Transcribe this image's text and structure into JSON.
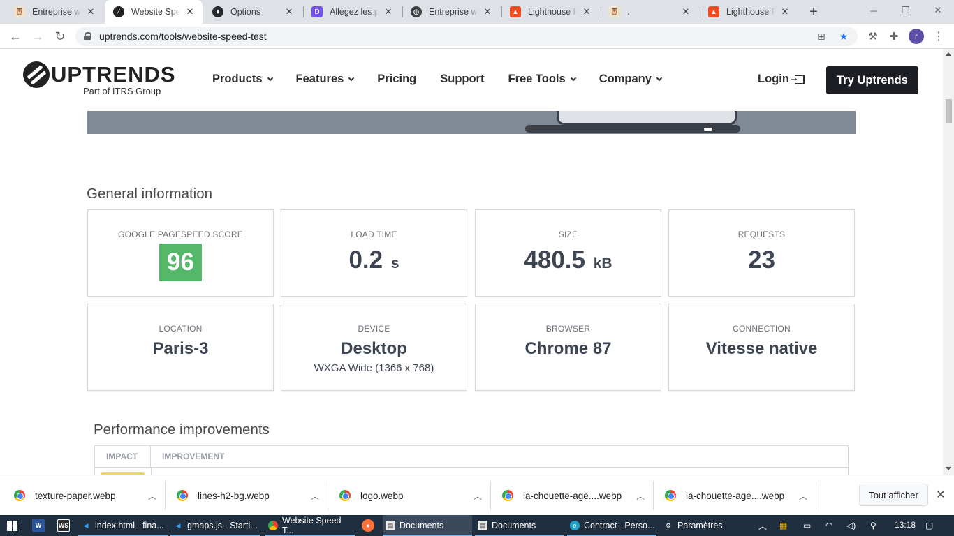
{
  "browser": {
    "tabs": [
      {
        "title": "Entreprise web",
        "favicon": "owl-icon",
        "active": false
      },
      {
        "title": "Website Speed",
        "favicon": "uptrends-icon",
        "active": true
      },
      {
        "title": "Options",
        "favicon": "github-icon",
        "active": false
      },
      {
        "title": "Allégez les pag",
        "favicon": "openclassrooms-icon",
        "active": false
      },
      {
        "title": "Entreprise web",
        "favicon": "globe-icon",
        "active": false
      },
      {
        "title": "Lighthouse Rep",
        "favicon": "lighthouse-icon",
        "active": false
      },
      {
        "title": ".",
        "favicon": "owl-icon",
        "active": false
      },
      {
        "title": "Lighthouse Rep",
        "favicon": "lighthouse-icon",
        "active": false
      }
    ],
    "url": "uptrends.com/tools/website-speed-test",
    "profile_initial": "r"
  },
  "site": {
    "logo_text": "UPTRENDS",
    "logo_sub": "Part of ITRS Group",
    "nav": {
      "products": "Products",
      "features": "Features",
      "pricing": "Pricing",
      "support": "Support",
      "free_tools": "Free Tools",
      "company": "Company"
    },
    "login": "Login",
    "try": "Try Uptrends"
  },
  "general": {
    "title": "General information",
    "pagespeed": {
      "label": "Google PageSpeed Score",
      "value": "96",
      "color": "#55b769"
    },
    "load_time": {
      "label": "Load time",
      "value": "0.2",
      "unit": "s"
    },
    "size": {
      "label": "Size",
      "value": "480.5",
      "unit": "kB"
    },
    "requests": {
      "label": "Requests",
      "value": "23"
    },
    "location": {
      "label": "Location",
      "value": "Paris-3"
    },
    "device": {
      "label": "Device",
      "value": "Desktop",
      "sub": "WXGA Wide (1366 x 768)"
    },
    "browser": {
      "label": "Browser",
      "value": "Chrome 87"
    },
    "connection": {
      "label": "Connection",
      "value": "Vitesse native"
    }
  },
  "performance": {
    "title": "Performance improvements",
    "col_impact": "Impact",
    "col_improvement": "Improvement"
  },
  "downloads": {
    "items": [
      "texture-paper.webp",
      "lines-h2-bg.webp",
      "logo.webp",
      "la-chouette-age....webp",
      "la-chouette-age....webp"
    ],
    "show_all": "Tout afficher"
  },
  "taskbar": {
    "apps": [
      {
        "label": "index.html - fina...",
        "icon": "vscode-icon"
      },
      {
        "label": "gmaps.js - Starti...",
        "icon": "vscode-icon"
      },
      {
        "label": "Website Speed T...",
        "icon": "chrome-icon"
      },
      {
        "label": "Documents",
        "icon": "folder-icon"
      },
      {
        "label": "Documents",
        "icon": "notepad-icon"
      },
      {
        "label": "Contract - Perso...",
        "icon": "edge-icon"
      },
      {
        "label": "Paramètres",
        "icon": "gear-icon"
      }
    ],
    "time": "13:18"
  }
}
